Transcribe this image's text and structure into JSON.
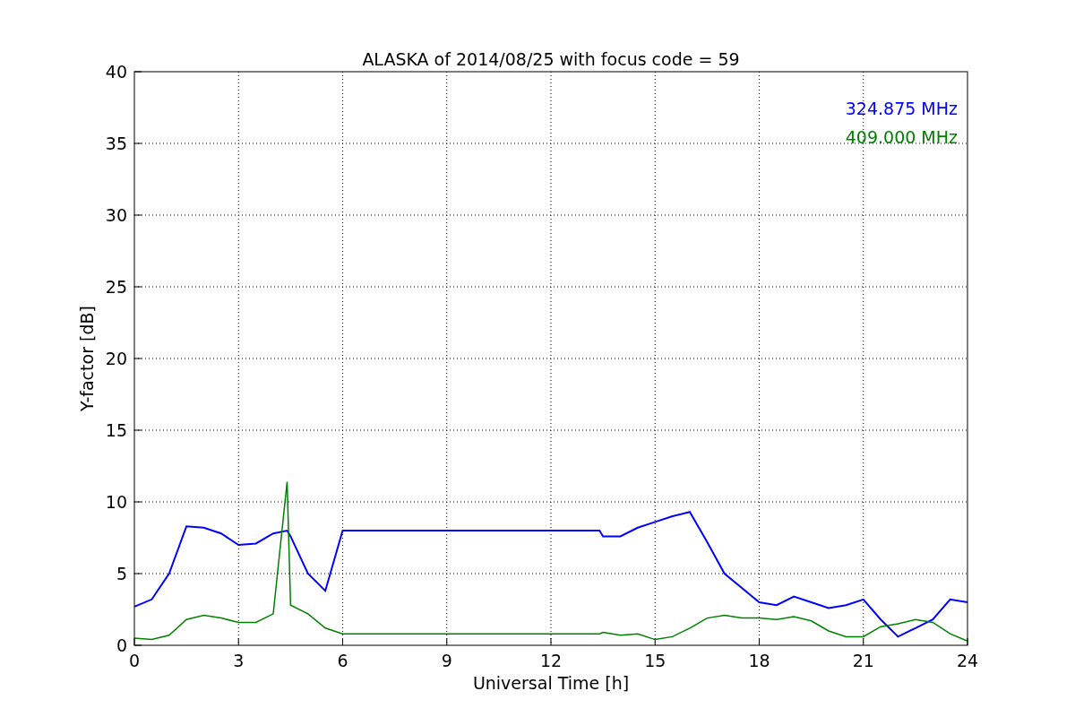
{
  "chart_data": {
    "type": "line",
    "title": "ALASKA of 2014/08/25 with focus code = 59",
    "xlabel": "Universal Time [h]",
    "ylabel": "Y-factor [dB]",
    "x": [
      0,
      0.5,
      1,
      1.5,
      2,
      2.5,
      3,
      3.5,
      4,
      4.4,
      4.5,
      5,
      5.5,
      6,
      6.5,
      13.4,
      13.5,
      14,
      14.5,
      15,
      15.5,
      16,
      16.5,
      17,
      17.5,
      18,
      18.5,
      19,
      19.5,
      20,
      20.5,
      21,
      21.5,
      22,
      22.5,
      23,
      23.5,
      24
    ],
    "series": [
      {
        "name": "324.875 MHz",
        "color": "#0000ff",
        "values": [
          2.7,
          3.2,
          5.0,
          8.3,
          8.2,
          7.8,
          7.0,
          7.1,
          7.8,
          8.0,
          7.6,
          5.0,
          3.8,
          8.0,
          8.0,
          8.0,
          7.6,
          7.6,
          8.2,
          8.6,
          9.0,
          9.3,
          7.2,
          5.0,
          4.0,
          3.0,
          2.8,
          3.4,
          3.0,
          2.6,
          2.8,
          3.2,
          1.8,
          0.6,
          1.2,
          1.8,
          3.2,
          3.0
        ]
      },
      {
        "name": "409.000 MHz",
        "color": "#008000",
        "values": [
          0.5,
          0.4,
          0.7,
          1.8,
          2.1,
          1.9,
          1.6,
          1.6,
          2.2,
          11.4,
          2.8,
          2.2,
          1.2,
          0.8,
          0.8,
          0.8,
          0.9,
          0.7,
          0.8,
          0.4,
          0.6,
          1.2,
          1.9,
          2.1,
          1.9,
          1.9,
          1.8,
          2.0,
          1.7,
          1.0,
          0.6,
          0.6,
          1.3,
          1.5,
          1.8,
          1.6,
          0.8,
          0.3
        ]
      }
    ],
    "grid": true,
    "xlim": [
      0,
      24
    ],
    "ylim": [
      0,
      40
    ],
    "xticks": [
      0,
      3,
      6,
      9,
      12,
      15,
      18,
      21,
      24
    ],
    "yticks": [
      0,
      5,
      10,
      15,
      20,
      25,
      30,
      35,
      40
    ]
  }
}
